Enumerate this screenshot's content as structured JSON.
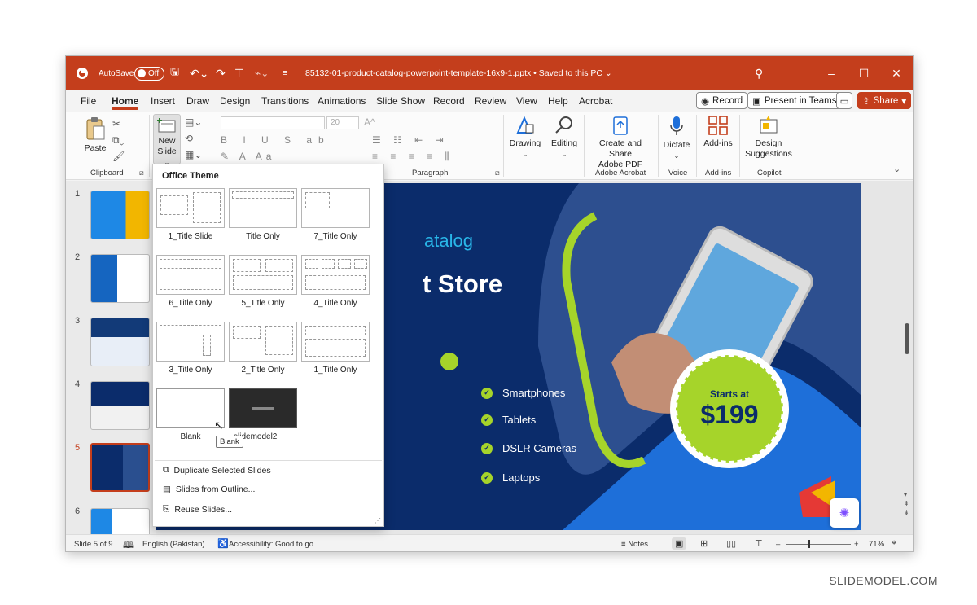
{
  "titlebar": {
    "autosave": "AutoSave",
    "autosave_state": "Off",
    "filename": "85132-01-product-catalog-powerpoint-template-16x9-1.pptx",
    "saved": "Saved to this PC",
    "filename_chevron": "⌄"
  },
  "tabs": [
    "File",
    "Home",
    "Insert",
    "Draw",
    "Design",
    "Transitions",
    "Animations",
    "Slide Show",
    "Record",
    "Review",
    "View",
    "Help",
    "Acrobat"
  ],
  "actions": {
    "record": "Record",
    "teams": "Present in Teams",
    "share": "Share"
  },
  "ribbon": {
    "paste": "Paste",
    "clipboard": "Clipboard",
    "new_slide_line1": "New",
    "new_slide_line2": "Slide",
    "font_size": "20",
    "paragraph": "Paragraph",
    "drawing": "Drawing",
    "editing": "Editing",
    "create_share_line1": "Create and Share",
    "create_share_line2": "Adobe PDF",
    "adobe_acrobat": "Adobe Acrobat",
    "dictate": "Dictate",
    "voice": "Voice",
    "addins": "Add-ins",
    "addins_group": "Add-ins",
    "design_line1": "Design",
    "design_line2": "Suggestions",
    "copilot": "Copilot"
  },
  "dropdown": {
    "header": "Office Theme",
    "layouts": [
      "1_Title Slide",
      "Title Only",
      "7_Title Only",
      "6_Title Only",
      "5_Title Only",
      "4_Title Only",
      "3_Title Only",
      "2_Title Only",
      "1_Title Only",
      "Blank",
      "slidemodel2"
    ],
    "commands": [
      "Duplicate Selected Slides",
      "Slides from Outline...",
      "Reuse Slides..."
    ],
    "tooltip": "Blank"
  },
  "slides": {
    "numbers": [
      "1",
      "2",
      "3",
      "4",
      "5",
      "6"
    ],
    "selected": "5"
  },
  "slide": {
    "subtitle": "atalog",
    "title": "t Store",
    "bullets": [
      "Smartphones",
      "Tablets",
      "DSLR Cameras",
      "Laptops"
    ],
    "badge_small": "Starts at",
    "badge_price": "$199",
    "colors": {
      "bg": "#0b2c6b",
      "accent": "#a6d42a",
      "cyan": "#29b6e8"
    }
  },
  "status": {
    "slide": "Slide 5 of 9",
    "language": "English (Pakistan)",
    "accessibility": "Accessibility: Good to go",
    "notes": "Notes",
    "zoom": "71%"
  },
  "watermark": "SLIDEMODEL.COM"
}
